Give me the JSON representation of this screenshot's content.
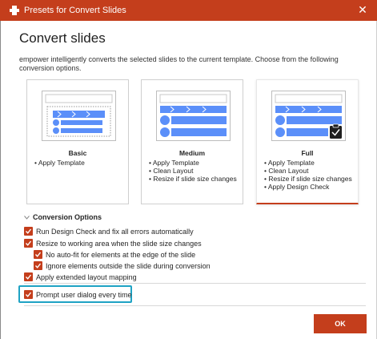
{
  "window": {
    "title": "Presets for Convert Slides",
    "close_glyph": "✕"
  },
  "dialog": {
    "heading": "Convert slides",
    "description": "empower intelligently converts the selected slides to the current template. Choose from the following conversion options."
  },
  "presets": [
    {
      "title": "Basic",
      "items": [
        "• Apply Template"
      ]
    },
    {
      "title": "Medium",
      "items": [
        "• Apply Template",
        "• Clean Layout",
        "• Resize if slide size changes"
      ]
    },
    {
      "title": "Full",
      "items": [
        "• Apply Template",
        "• Clean Layout",
        "• Resize if slide size changes",
        "• Apply Design Check"
      ],
      "selected": true
    }
  ],
  "options": {
    "section_label": "Conversion Options",
    "run_design_check": {
      "label": "Run Design Check and fix all errors automatically",
      "checked": true
    },
    "resize_working_area": {
      "label": "Resize to working area when the slide size changes",
      "checked": true
    },
    "no_autofit": {
      "label": "No auto-fit for elements at the edge of the slide",
      "checked": true
    },
    "ignore_outside": {
      "label": "Ignore elements outside the slide during conversion",
      "checked": true
    },
    "extended_mapping": {
      "label": "Apply extended layout mapping",
      "checked": true
    },
    "prompt_dialog": {
      "label": "Prompt user dialog every time",
      "checked": true
    }
  },
  "footer": {
    "ok_label": "OK"
  },
  "colors": {
    "accent": "#c43e1c",
    "highlight": "#1fa3c4",
    "thumb_blue": "#5b8ff9"
  },
  "icons": {
    "app": "empower-logo-icon",
    "close": "close-icon",
    "chevron": "chevron-down-icon",
    "check": "checkmark-icon",
    "badge": "clipboard-check-icon"
  }
}
